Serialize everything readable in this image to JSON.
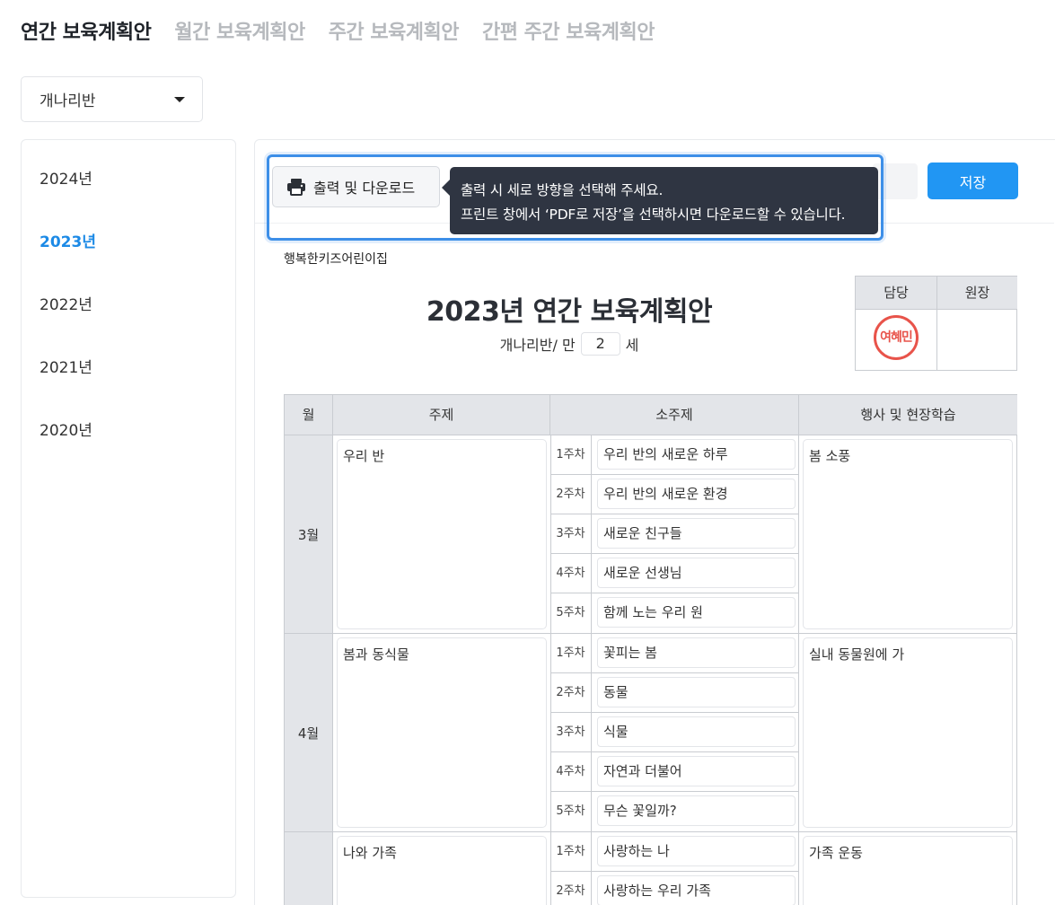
{
  "tabs": [
    {
      "label": "연간 보육계획안",
      "active": true
    },
    {
      "label": "월간 보육계획안",
      "active": false
    },
    {
      "label": "주간 보육계획안",
      "active": false
    },
    {
      "label": "간편 주간 보육계획안",
      "active": false
    }
  ],
  "class_select": {
    "value": "개나리반"
  },
  "years": [
    "2024년",
    "2023년",
    "2022년",
    "2021년",
    "2020년"
  ],
  "active_year": "2023년",
  "toolbar": {
    "print_label": "출력 및 다운로드",
    "save_label": "저장",
    "tooltip_line1": "출력 시 세로 방향을 선택해 주세요.",
    "tooltip_line2": "프린트 창에서 ‘PDF로 저장’을 선택하시면 다운로드할 수 있습니다."
  },
  "document": {
    "org_name": "행복한키즈어린이집",
    "title": "2023년 연간 보육계획안",
    "class_prefix": "개나리반/ 만",
    "age": "2",
    "age_suffix": "세",
    "approval": {
      "col1": "담당",
      "col2": "원장",
      "stamp_name": "여혜민"
    }
  },
  "table": {
    "headers": {
      "month": "월",
      "theme": "주제",
      "subtheme": "소주제",
      "events": "행사 및 현장학습"
    },
    "months": [
      {
        "month": "3월",
        "theme": "우리 반",
        "events": "봄 소풍",
        "weeks": [
          {
            "label": "1주차",
            "value": "우리 반의 새로운 하루"
          },
          {
            "label": "2주차",
            "value": "우리 반의 새로운 환경"
          },
          {
            "label": "3주차",
            "value": "새로운 친구들"
          },
          {
            "label": "4주차",
            "value": "새로운 선생님"
          },
          {
            "label": "5주차",
            "value": "함께 노는 우리 원"
          }
        ]
      },
      {
        "month": "4월",
        "theme": "봄과 동식물",
        "events": "실내 동물원에 가",
        "weeks": [
          {
            "label": "1주차",
            "value": "꽃피는 봄"
          },
          {
            "label": "2주차",
            "value": "동물"
          },
          {
            "label": "3주차",
            "value": "식물"
          },
          {
            "label": "4주차",
            "value": "자연과 더불어"
          },
          {
            "label": "5주차",
            "value": "무슨 꽃일까?"
          }
        ]
      },
      {
        "month": "",
        "theme": "나와 가족",
        "events": "가족 운동",
        "weeks": [
          {
            "label": "1주차",
            "value": "사랑하는 나"
          },
          {
            "label": "2주차",
            "value": "사랑하는 우리 가족"
          }
        ]
      }
    ]
  },
  "colors": {
    "accent": "#2196f3",
    "active_year": "#1c8ae6",
    "stamp": "#e8534a",
    "tooltip_bg": "#2f3542",
    "highlight": "#3d8fe8"
  }
}
